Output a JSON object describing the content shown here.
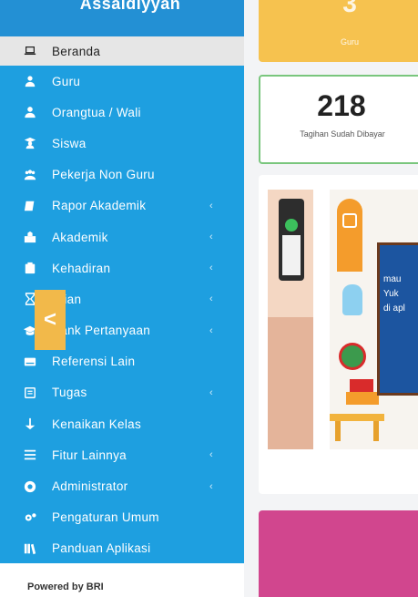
{
  "sidebar": {
    "brand": "Assaldiyyan",
    "items": [
      {
        "label": "Beranda",
        "icon": "laptop-icon",
        "active": true,
        "has_submenu": false
      },
      {
        "label": "Guru",
        "icon": "user-tie-icon",
        "active": false,
        "has_submenu": false
      },
      {
        "label": "Orangtua / Wali",
        "icon": "user-icon",
        "active": false,
        "has_submenu": false
      },
      {
        "label": "Siswa",
        "icon": "student-icon",
        "active": false,
        "has_submenu": false
      },
      {
        "label": "Pekerja Non Guru",
        "icon": "users-icon",
        "active": false,
        "has_submenu": false
      },
      {
        "label": "Rapor Akademik",
        "icon": "book-icon",
        "active": false,
        "has_submenu": true
      },
      {
        "label": "Akademik",
        "icon": "school-icon",
        "active": false,
        "has_submenu": true
      },
      {
        "label": "Kehadiran",
        "icon": "clipboard-icon",
        "active": false,
        "has_submenu": true
      },
      {
        "label": "Ujian",
        "icon": "hourglass-icon",
        "active": false,
        "has_submenu": true
      },
      {
        "label": "Bank Pertanyaan",
        "icon": "graduation-cap-icon",
        "active": false,
        "has_submenu": true
      },
      {
        "label": "Referensi Lain",
        "icon": "keyboard-icon",
        "active": false,
        "has_submenu": false
      },
      {
        "label": "Tugas",
        "icon": "tasks-icon",
        "active": false,
        "has_submenu": true
      },
      {
        "label": "Kenaikan Kelas",
        "icon": "level-up-icon",
        "active": false,
        "has_submenu": false
      },
      {
        "label": "Fitur Lainnya",
        "icon": "list-icon",
        "active": false,
        "has_submenu": true
      },
      {
        "label": "Administrator",
        "icon": "admin-icon",
        "active": false,
        "has_submenu": true
      },
      {
        "label": "Pengaturan Umum",
        "icon": "cogs-icon",
        "active": false,
        "has_submenu": false
      },
      {
        "label": "Panduan Aplikasi",
        "icon": "library-icon",
        "active": false,
        "has_submenu": false
      }
    ],
    "chevron": "‹"
  },
  "footer": {
    "text": "Powered by BRI"
  },
  "cards": {
    "guru": {
      "value": "3",
      "label": "Guru"
    },
    "tagihan": {
      "value": "218",
      "label": "Tagihan Sudah Dibayar"
    }
  },
  "carousel": {
    "prev_label": "<",
    "board_lines": [
      "mau",
      "Yuk",
      "di apl"
    ]
  },
  "colors": {
    "sidebar_bg": "#1e9fe0",
    "guru_card": "#f6c24f",
    "tagihan_border": "#79c67d",
    "pink_card": "#d1468e"
  }
}
